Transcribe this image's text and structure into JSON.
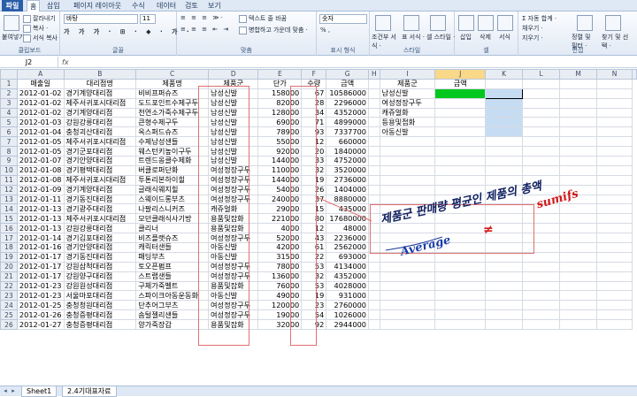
{
  "ribbon_tabs": [
    "파일",
    "홈",
    "삽입",
    "페이지 레이아웃",
    "수식",
    "데이터",
    "검토",
    "보기"
  ],
  "ribbon": {
    "paste": "붙여넣기",
    "cut": "잘라내기",
    "copy": "복사 ·",
    "format_painter": "서식 복사",
    "clipboard": "클립보드",
    "font_name": "바탕",
    "font_size": "11",
    "font": "글꼴",
    "alignment": "맞춤",
    "wrap": "텍스트 줄 바꿈",
    "merge": "병합하고 가운데 맞춤 ·",
    "number_format": "숫자",
    "number": "표시 형식",
    "percent": "%  ,",
    "cond_format": "조건부 서식 ·",
    "table_format": "표 서식 ·",
    "cell_style": "셀 스타일 ·",
    "style": "스타일",
    "insert": "삽입",
    "delete": "삭제",
    "format": "서식",
    "cells": "셀",
    "autosum": "Σ 자동 합계 ·",
    "fill": "채우기 ·",
    "clear": "지우기 ·",
    "sort_filter": "정렬 및 필터 ·",
    "find_select": "찾기 및 선택 ·",
    "editing": "편집"
  },
  "name_box": "J2",
  "fx": "fx",
  "columns": [
    "A",
    "B",
    "C",
    "D",
    "E",
    "F",
    "G",
    "H",
    "I",
    "J",
    "K",
    "L",
    "M",
    "N"
  ],
  "rows": [
    [
      "1",
      "매출일",
      "대리점명",
      "제품명",
      "제품군",
      "단가",
      "수량",
      "금액",
      "",
      "제품군",
      "금액",
      "",
      "",
      ""
    ],
    [
      "2",
      "2012-01-02",
      "경기계양대리점",
      "비비프퍼슈즈",
      "남성신발",
      "158000",
      "67",
      "10586000",
      "",
      "남성신발",
      "",
      "",
      "",
      ""
    ],
    [
      "3",
      "2012-01-02",
      "제주서귀포시대리점",
      "도드포인트수제구두",
      "남성신발",
      "82000",
      "28",
      "2296000",
      "",
      "여성정장구두",
      "",
      "",
      "",
      ""
    ],
    [
      "4",
      "2012-01-02",
      "경기계양대리점",
      "천연소가죽수제구두",
      "남성신발",
      "128000",
      "34",
      "4352000",
      "",
      "캐쥬얼화",
      "",
      "",
      "",
      ""
    ],
    [
      "5",
      "2012-01-03",
      "강원강릉대리점",
      "큰형수제구두",
      "남성신발",
      "69000",
      "71",
      "4899000",
      "",
      "등용및접화",
      "",
      "",
      "",
      ""
    ],
    [
      "6",
      "2012-01-04",
      "충청괴산대리점",
      "옥스퍼드슈즈",
      "남성신발",
      "78900",
      "93",
      "7337700",
      "",
      "아동신발",
      "",
      "",
      "",
      ""
    ],
    [
      "7",
      "2012-01-05",
      "제주서귀포시대리점",
      "수제남성샌들",
      "남성신발",
      "55000",
      "12",
      "660000",
      "",
      "",
      "",
      "",
      "",
      ""
    ],
    [
      "8",
      "2012-01-05",
      "경기군포대리점",
      "웨스턴키높이구두",
      "남성신발",
      "92000",
      "20",
      "1840000",
      "",
      "",
      "",
      "",
      "",
      ""
    ],
    [
      "9",
      "2012-01-07",
      "경기안양대리점",
      "트렌드옹클수제화",
      "남성신발",
      "144000",
      "33",
      "4752000",
      "",
      "",
      "",
      "",
      "",
      ""
    ],
    [
      "10",
      "2012-01-08",
      "경기평택대리점",
      "버클로퍼단화",
      "여성정장구두",
      "110000",
      "32",
      "3520000",
      "",
      "",
      "",
      "",
      "",
      ""
    ],
    [
      "11",
      "2012-01-08",
      "제주서귀포시대리점",
      "투톤리본하이힐",
      "여성정장구두",
      "144000",
      "19",
      "2736000",
      "",
      "",
      "",
      "",
      "",
      ""
    ],
    [
      "12",
      "2012-01-09",
      "경기계양대리점",
      "글래식웨지힐",
      "여성정장구두",
      "54000",
      "26",
      "1404000",
      "",
      "",
      "",
      "",
      "",
      ""
    ],
    [
      "13",
      "2012-01-11",
      "경기동진대리점",
      "스웨이드롱부츠",
      "여성정장구두",
      "240000",
      "37",
      "8880000",
      "",
      "",
      "",
      "",
      "",
      ""
    ],
    [
      "14",
      "2012-01-13",
      "경기광주대리점",
      "나팔리스니커즈",
      "캐쥬얼화",
      "29000",
      "15",
      "435000",
      "",
      "",
      "",
      "",
      "",
      ""
    ],
    [
      "15",
      "2012-01-13",
      "제주서귀포시대리점",
      "모던클래식사기방",
      "용품및잡화",
      "221000",
      "80",
      "17680000",
      "",
      "",
      "",
      "",
      "",
      ""
    ],
    [
      "16",
      "2012-01-13",
      "강원강릉대리점",
      "클리너",
      "용품및잡화",
      "4000",
      "12",
      "48000",
      "",
      "",
      "",
      "",
      "",
      ""
    ],
    [
      "17",
      "2012-01-14",
      "경기김포대리점",
      "비즈플랫슈즈",
      "여성정장구두",
      "52000",
      "43",
      "2236000",
      "",
      "",
      "",
      "",
      "",
      ""
    ],
    [
      "18",
      "2012-01-16",
      "경기안양대리점",
      "캐릭터샌들",
      "아동신발",
      "42000",
      "61",
      "2562000",
      "",
      "",
      "",
      "",
      "",
      ""
    ],
    [
      "19",
      "2012-01-17",
      "경기동진대리점",
      "패딩부츠",
      "아동신발",
      "31500",
      "22",
      "693000",
      "",
      "",
      "",
      "",
      "",
      ""
    ],
    [
      "20",
      "2012-01-17",
      "강원삼척대리점",
      "토오픈펌프",
      "여성정장구두",
      "78000",
      "53",
      "4134000",
      "",
      "",
      "",
      "",
      "",
      ""
    ],
    [
      "21",
      "2012-01-17",
      "강원양구대리점",
      "스트랩샌들",
      "여성정장구두",
      "136000",
      "32",
      "4352000",
      "",
      "",
      "",
      "",
      "",
      ""
    ],
    [
      "22",
      "2012-01-23",
      "강원원성대리점",
      "구체가죽벨트",
      "용품및잡화",
      "76000",
      "53",
      "4028000",
      "",
      "",
      "",
      "",
      "",
      ""
    ],
    [
      "23",
      "2012-01-23",
      "서울마포대리점",
      "스파이크아동운동화",
      "아동신발",
      "49000",
      "19",
      "931000",
      "",
      "",
      "",
      "",
      "",
      ""
    ],
    [
      "24",
      "2012-01-25",
      "충청청원대리점",
      "단추어그부츠",
      "여성정장구두",
      "120000",
      "23",
      "2760000",
      "",
      "",
      "",
      "",
      "",
      ""
    ],
    [
      "25",
      "2012-01-26",
      "충청증평대리점",
      "솜털젤리샌들",
      "여성정장구두",
      "19000",
      "54",
      "1026000",
      "",
      "",
      "",
      "",
      "",
      ""
    ],
    [
      "26",
      "2012-01-27",
      "충청증평대리점",
      "양가죽장갑",
      "용품및잡화",
      "32000",
      "92",
      "2944000",
      "",
      "",
      "",
      "",
      "",
      ""
    ]
  ],
  "handwriting": {
    "main": "제품군 판매량 평균인 제품의 총액",
    "average": "Average",
    "sumifs": "sumifs",
    "mark": "≠"
  },
  "sheet_tabs": [
    "Sheet1",
    "2.4기대표자료"
  ]
}
